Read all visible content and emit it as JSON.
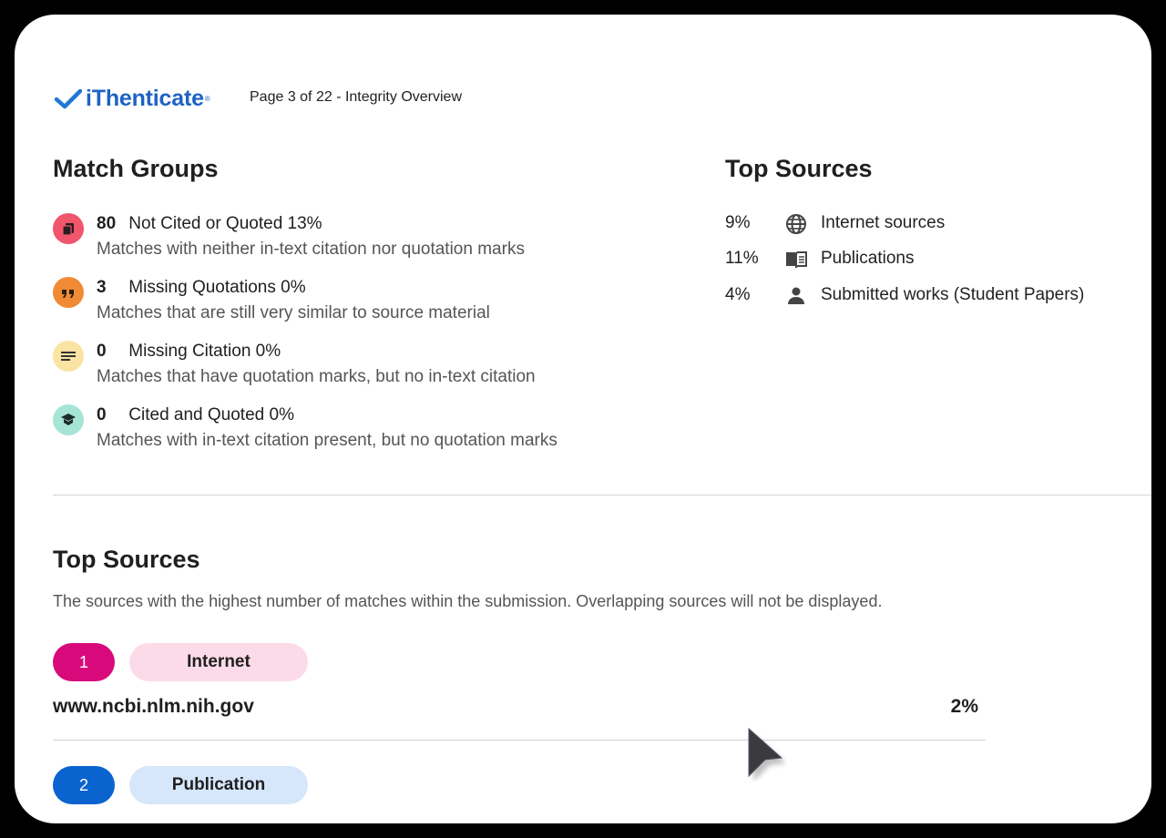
{
  "header": {
    "logo_text": "iThenticate",
    "page_label": "Page 3 of 22 - Integrity Overview"
  },
  "match_groups": {
    "title": "Match Groups",
    "items": [
      {
        "count": "80",
        "label": "Not Cited or Quoted 13%",
        "description": "Matches with neither in-text citation nor quotation marks",
        "icon": "copy-stack-icon",
        "color": "#f1566d"
      },
      {
        "count": "3",
        "label": "Missing Quotations 0%",
        "description": "Matches that are still very similar to source material",
        "icon": "quote-icon",
        "color": "#f08a34"
      },
      {
        "count": "0",
        "label": "Missing Citation 0%",
        "description": "Matches that have quotation marks, but no in-text citation",
        "icon": "text-lines-icon",
        "color": "#fbe3a3"
      },
      {
        "count": "0",
        "label": "Cited and Quoted 0%",
        "description": "Matches with in-text citation present, but no quotation marks",
        "icon": "graduation-cap-icon",
        "color": "#a6e4d6"
      }
    ]
  },
  "top_sources_summary": {
    "title": "Top Sources",
    "rows": [
      {
        "percent": "9%",
        "label": "Internet sources",
        "icon": "globe-icon"
      },
      {
        "percent": "11%",
        "label": "Publications",
        "icon": "book-icon"
      },
      {
        "percent": "4%",
        "label": "Submitted works (Student Papers)",
        "icon": "person-icon"
      }
    ]
  },
  "top_sources": {
    "title": "Top Sources",
    "description": "The sources with the highest number of matches within the submission. Overlapping sources will not be displayed.",
    "items": [
      {
        "rank": "1",
        "type": "Internet",
        "url": "www.ncbi.nlm.nih.gov",
        "percent": "2%",
        "rank_color": "#d80a7b",
        "type_color": "#fcdbe8"
      },
      {
        "rank": "2",
        "type": "Publication",
        "url": "",
        "percent": "",
        "rank_color": "#0a63cf",
        "type_color": "#d6e6fb"
      }
    ]
  }
}
